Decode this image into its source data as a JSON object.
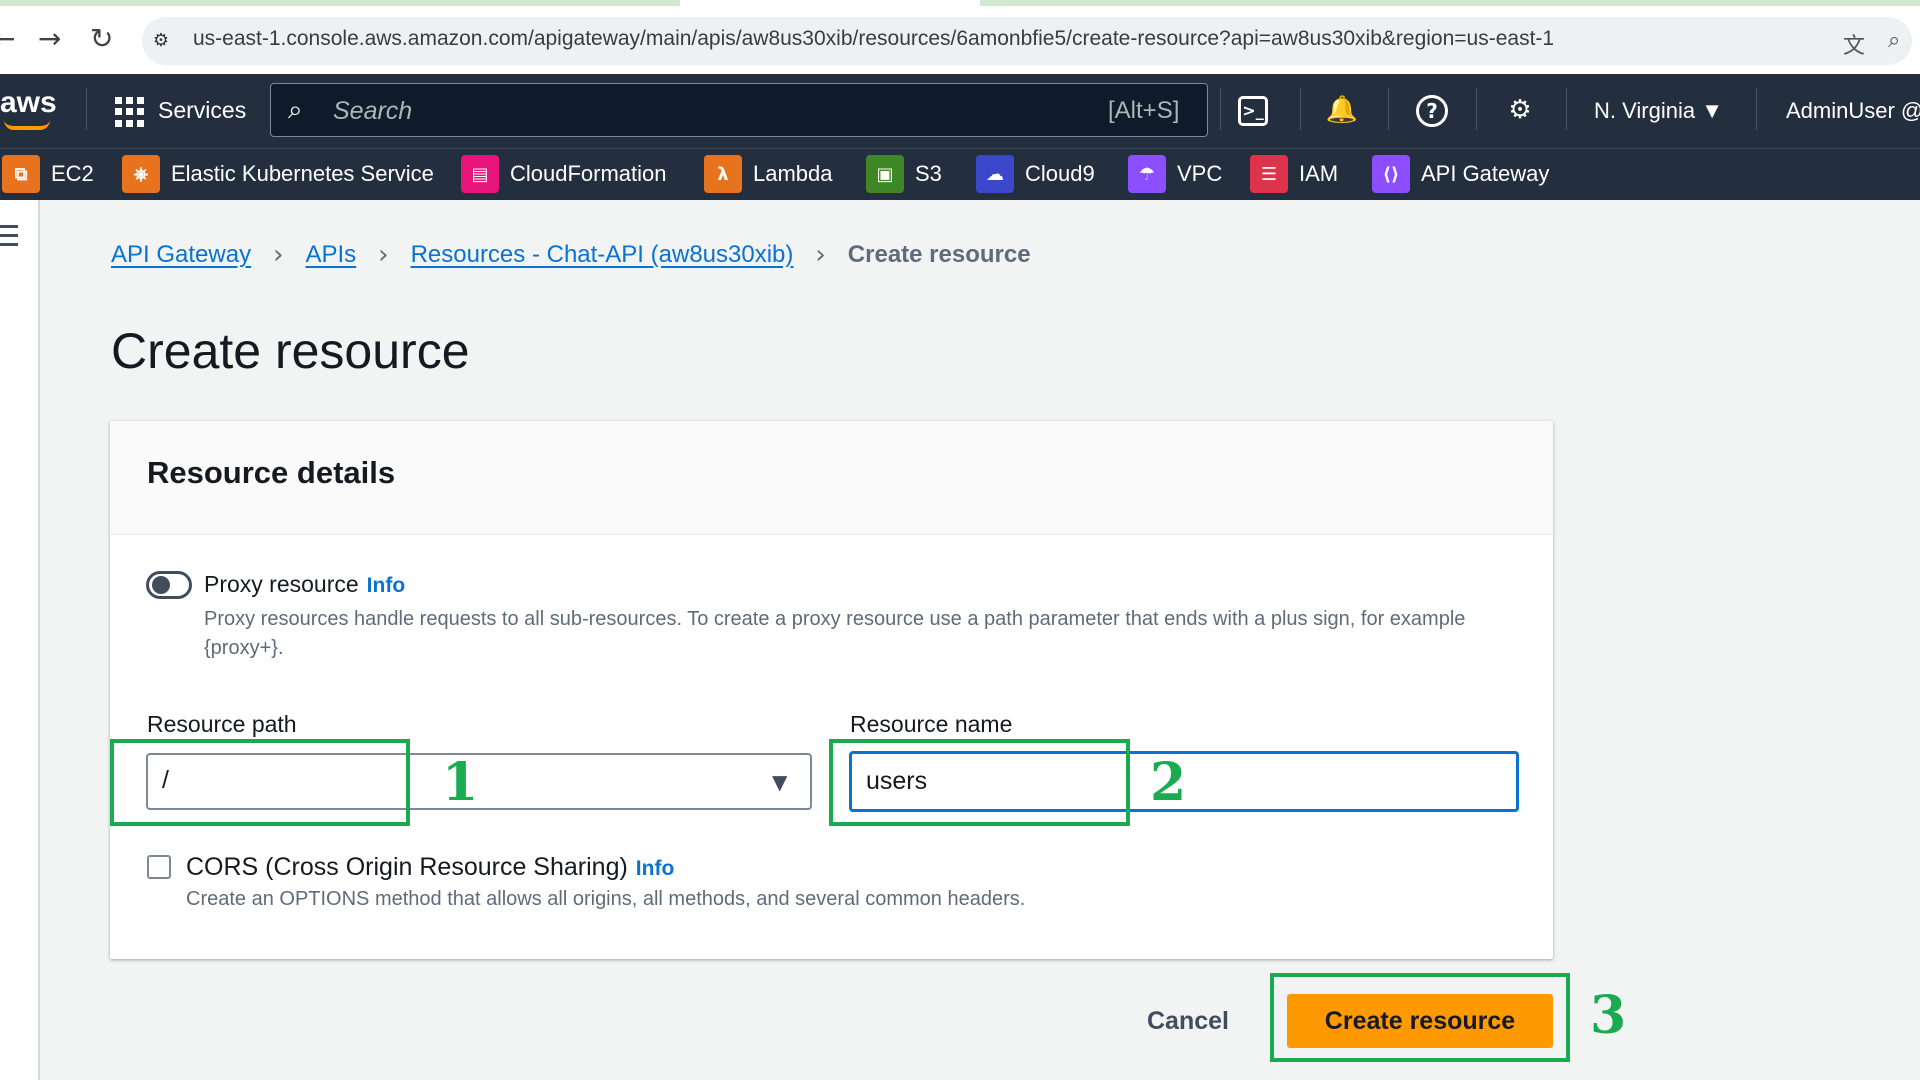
{
  "browser": {
    "back": "←",
    "forward": "→",
    "reload": "↻",
    "url": "us-east-1.console.aws.amazon.com/apigateway/main/apis/aw8us30xib/resources/6amonbfie5/create-resource?api=aw8us30xib&region=us-east-1",
    "site_icon": "⚙",
    "translate_icon": "文",
    "zoom_icon": "⌕"
  },
  "header": {
    "logo": "aws",
    "services_label": "Services",
    "search_placeholder": "Search",
    "search_shortcut": "[Alt+S]",
    "cloudshell_icon": ">_",
    "bell_icon": "🔔",
    "help_icon": "?",
    "settings_icon": "⚙",
    "region": "N. Virginia ▼",
    "user": "AdminUser @"
  },
  "favorites": [
    {
      "label": "EC2",
      "icon": "⧉",
      "color": "#e8731e"
    },
    {
      "label": "Elastic Kubernetes Service",
      "icon": "⎈",
      "color": "#e8731e"
    },
    {
      "label": "CloudFormation",
      "icon": "▤",
      "color": "#e7157b"
    },
    {
      "label": "Lambda",
      "icon": "λ",
      "color": "#e8731e"
    },
    {
      "label": "S3",
      "icon": "▣",
      "color": "#3f8624"
    },
    {
      "label": "Cloud9",
      "icon": "☁",
      "color": "#3b48cc"
    },
    {
      "label": "VPC",
      "icon": "☂",
      "color": "#8c4fff"
    },
    {
      "label": "IAM",
      "icon": "☰",
      "color": "#dd344c"
    },
    {
      "label": "API Gateway",
      "icon": "⟨⟩",
      "color": "#8c4fff"
    }
  ],
  "breadcrumb": {
    "items": [
      "API Gateway",
      "APIs",
      "Resources - Chat-API (aw8us30xib)"
    ],
    "current": "Create resource",
    "separator": "›"
  },
  "page": {
    "title": "Create resource"
  },
  "form": {
    "section_title": "Resource details",
    "proxy_label": "Proxy resource",
    "info": "Info",
    "proxy_desc": "Proxy resources handle requests to all sub-resources. To create a proxy resource use a path parameter that ends with a plus sign, for example {proxy+}.",
    "path_label": "Resource path",
    "path_value": "/",
    "caret": "▼",
    "name_label": "Resource name",
    "name_value": "users",
    "cors_label": "CORS (Cross Origin Resource Sharing)",
    "cors_desc": "Create an OPTIONS method that allows all origins, all methods, and several common headers.",
    "cancel": "Cancel",
    "submit": "Create resource"
  },
  "annotations": [
    "1",
    "2",
    "3"
  ],
  "colors": {
    "accent": "#0972d3",
    "primary_button": "#ff9900",
    "header_bg": "#232f3e",
    "annotation": "#1aab50"
  }
}
